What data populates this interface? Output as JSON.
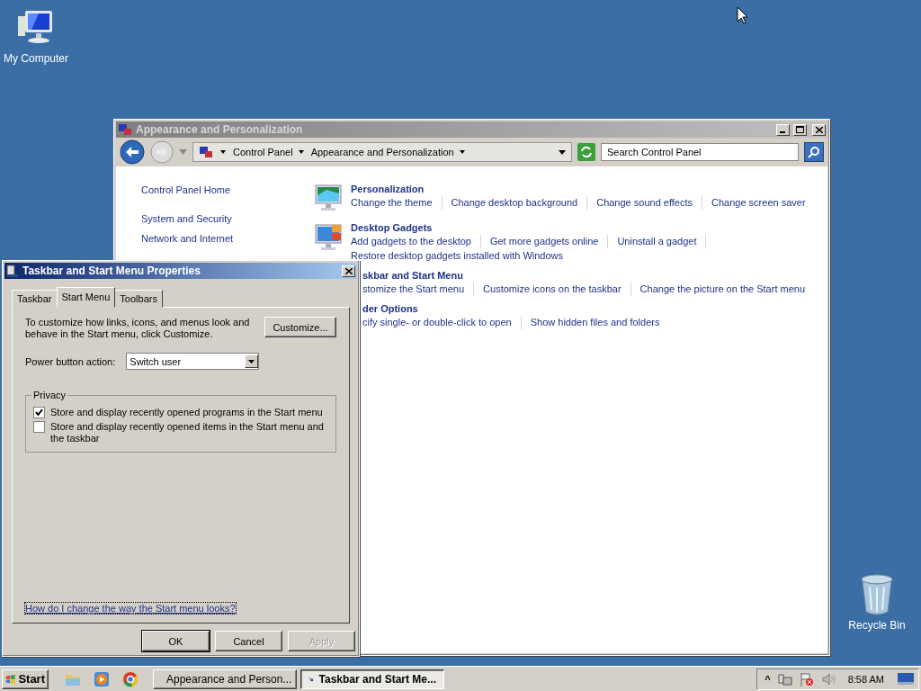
{
  "desktop_icons": [
    {
      "label": "My Computer",
      "kind": "computer"
    },
    {
      "label": "Recycle Bin",
      "kind": "recycle"
    }
  ],
  "control_panel": {
    "title": "Appearance and Personalization",
    "address": [
      "Control Panel",
      "Appearance and Personalization"
    ],
    "search": {
      "placeholder": "Search Control Panel"
    },
    "nav": [
      "Control Panel Home",
      "System and Security",
      "Network and Internet"
    ],
    "sections": [
      {
        "heading": "Personalization",
        "links": [
          "Change the theme",
          "Change desktop background",
          "Change sound effects",
          "Change screen saver"
        ]
      },
      {
        "heading": "Desktop Gadgets",
        "links": [
          "Add gadgets to the desktop",
          "Get more gadgets online",
          "Uninstall a gadget",
          "Restore desktop gadgets installed with Windows"
        ]
      },
      {
        "heading": "skbar and Start Menu",
        "links": [
          "stomize the Start menu",
          "Customize icons on the taskbar",
          "Change the picture on the Start menu"
        ]
      },
      {
        "heading": "der Options",
        "links": [
          "cify single- or double-click to open",
          "Show hidden files and folders"
        ]
      }
    ]
  },
  "dialog": {
    "title": "Taskbar and Start Menu Properties",
    "tabs": [
      {
        "label": "Taskbar",
        "selected": false
      },
      {
        "label": "Start Menu",
        "selected": true
      },
      {
        "label": "Toolbars",
        "selected": false
      }
    ],
    "description": "To customize how links, icons, and menus look and behave in the Start menu, click Customize.",
    "customize_button": "Customize...",
    "power_label": "Power button action:",
    "power_value": "Switch user",
    "privacy": {
      "legend": "Privacy",
      "checkboxes": [
        {
          "label": "Store and display recently opened programs in the Start menu",
          "checked": true
        },
        {
          "label": "Store and display recently opened items in the Start menu and the taskbar",
          "checked": false
        }
      ]
    },
    "help_link": "How do I change the way the Start menu looks?",
    "buttons": [
      {
        "label": "OK",
        "disabled": false
      },
      {
        "label": "Cancel",
        "disabled": false
      },
      {
        "label": "Apply",
        "disabled": true
      }
    ]
  },
  "taskbar": {
    "start": "Start",
    "tasks": [
      {
        "label": "Appearance and Person...",
        "selected": false
      },
      {
        "label": "Taskbar and Start Me...",
        "selected": true
      }
    ],
    "tray_chevron": "^",
    "clock": "8:58 AM"
  }
}
